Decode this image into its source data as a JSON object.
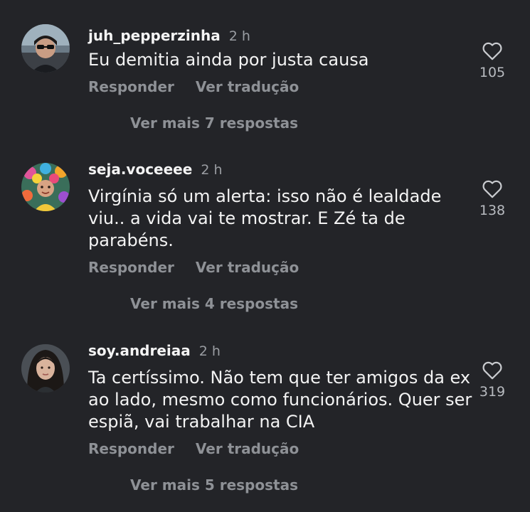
{
  "comments": [
    {
      "username": "juh_pepperzinha",
      "time": "2 h",
      "text": "Eu demitia ainda por justa causa",
      "reply_label": "Responder",
      "translate_label": "Ver tradução",
      "more_replies_label": "Ver mais 7 respostas",
      "likes": "105",
      "avatar": "avatar-person-sunglasses-car"
    },
    {
      "username": "seja.voceeee",
      "time": "2 h",
      "text": "Virgínia só um alerta: isso não é lealdade viu.. a vida vai te mostrar. E Zé ta de parabéns.",
      "reply_label": "Responder",
      "translate_label": "Ver tradução",
      "more_replies_label": "Ver mais 4 respostas",
      "likes": "138",
      "avatar": "avatar-colorful-flowers"
    },
    {
      "username": "soy.andreiaa",
      "time": "2 h",
      "text": "Ta certíssimo.  Não tem que ter amigos da ex ao lado, mesmo como funcionários. Quer ser espiã, vai trabalhar na CIA",
      "reply_label": "Responder",
      "translate_label": "Ver tradução",
      "more_replies_label": "Ver mais 5 respostas",
      "likes": "319",
      "avatar": "avatar-woman-dark-hair"
    }
  ],
  "colors": {
    "background": "#232428",
    "text": "#f3f3f3",
    "muted": "#8e9196"
  },
  "icons": {
    "like": "heart-outline-icon"
  }
}
